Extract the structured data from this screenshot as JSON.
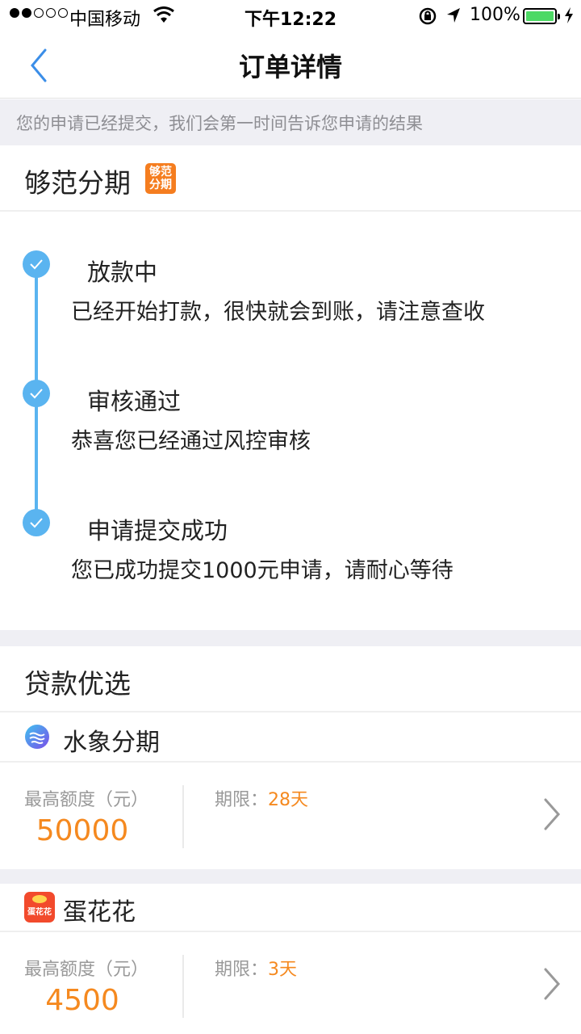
{
  "status_bar": {
    "carrier": "中国移动",
    "time": "下午12:22",
    "battery": "100%"
  },
  "nav": {
    "title": "订单详情"
  },
  "notice": "您的申请已经提交，我们会第一时间告诉您申请的结果",
  "lender": {
    "name": "够范分期",
    "logo_text_1": "够范",
    "logo_text_2": "分期"
  },
  "timeline": [
    {
      "title": "放款中",
      "desc": "已经开始打款，很快就会到账，请注意查收"
    },
    {
      "title": "审核通过",
      "desc": "恭喜您已经通过风控审核"
    },
    {
      "title": "申请提交成功",
      "desc": "您已成功提交1000元申请，请耐心等待"
    }
  ],
  "recommend": {
    "title": "贷款优选",
    "products": [
      {
        "name": "水象分期",
        "amount_label": "最高额度（元）",
        "amount": "50000",
        "term_label": "期限：",
        "term": "28天"
      },
      {
        "name": "蛋花花",
        "icon_text": "蛋花花",
        "amount_label": "最高额度（元）",
        "amount": "4500",
        "term_label": "期限：",
        "term": "3天"
      }
    ]
  },
  "colors": {
    "accent_blue": "#5ab4f0",
    "orange": "#f5891f",
    "battery_green": "#4cd964"
  }
}
